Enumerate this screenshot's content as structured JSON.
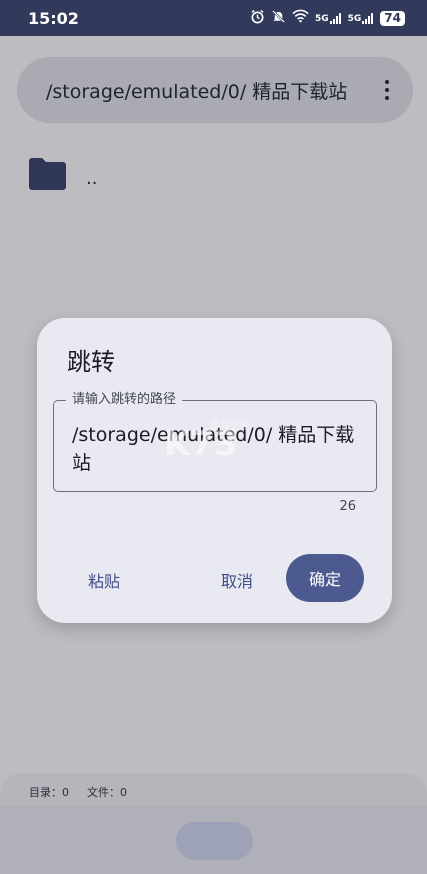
{
  "status_bar": {
    "time": "15:02",
    "icons": [
      "alarm-icon",
      "mute-icon",
      "wifi-icon",
      "5g-signal-icon",
      "5g-signal-icon"
    ],
    "net1": "5G",
    "net2": "5G",
    "battery": "74"
  },
  "path_bar": {
    "path": "/storage/emulated/0/ 精品下载站",
    "menu_icon": "more-vert-icon"
  },
  "file_list": [
    {
      "icon": "folder-icon",
      "label": ".."
    }
  ],
  "dialog": {
    "title": "跳转",
    "field_label": "请输入跳转的路径",
    "field_value": "/storage/emulated/0/ 精品下载站",
    "char_count": "26",
    "paste_label": "粘贴",
    "cancel_label": "取消",
    "confirm_label": "确定"
  },
  "bottom": {
    "dirs": "目录：0",
    "files": "文件：0"
  },
  "colors": {
    "status_bar": "#323a5b",
    "accent": "#4d5a8f",
    "dialog_bg": "#e9e9f1"
  }
}
